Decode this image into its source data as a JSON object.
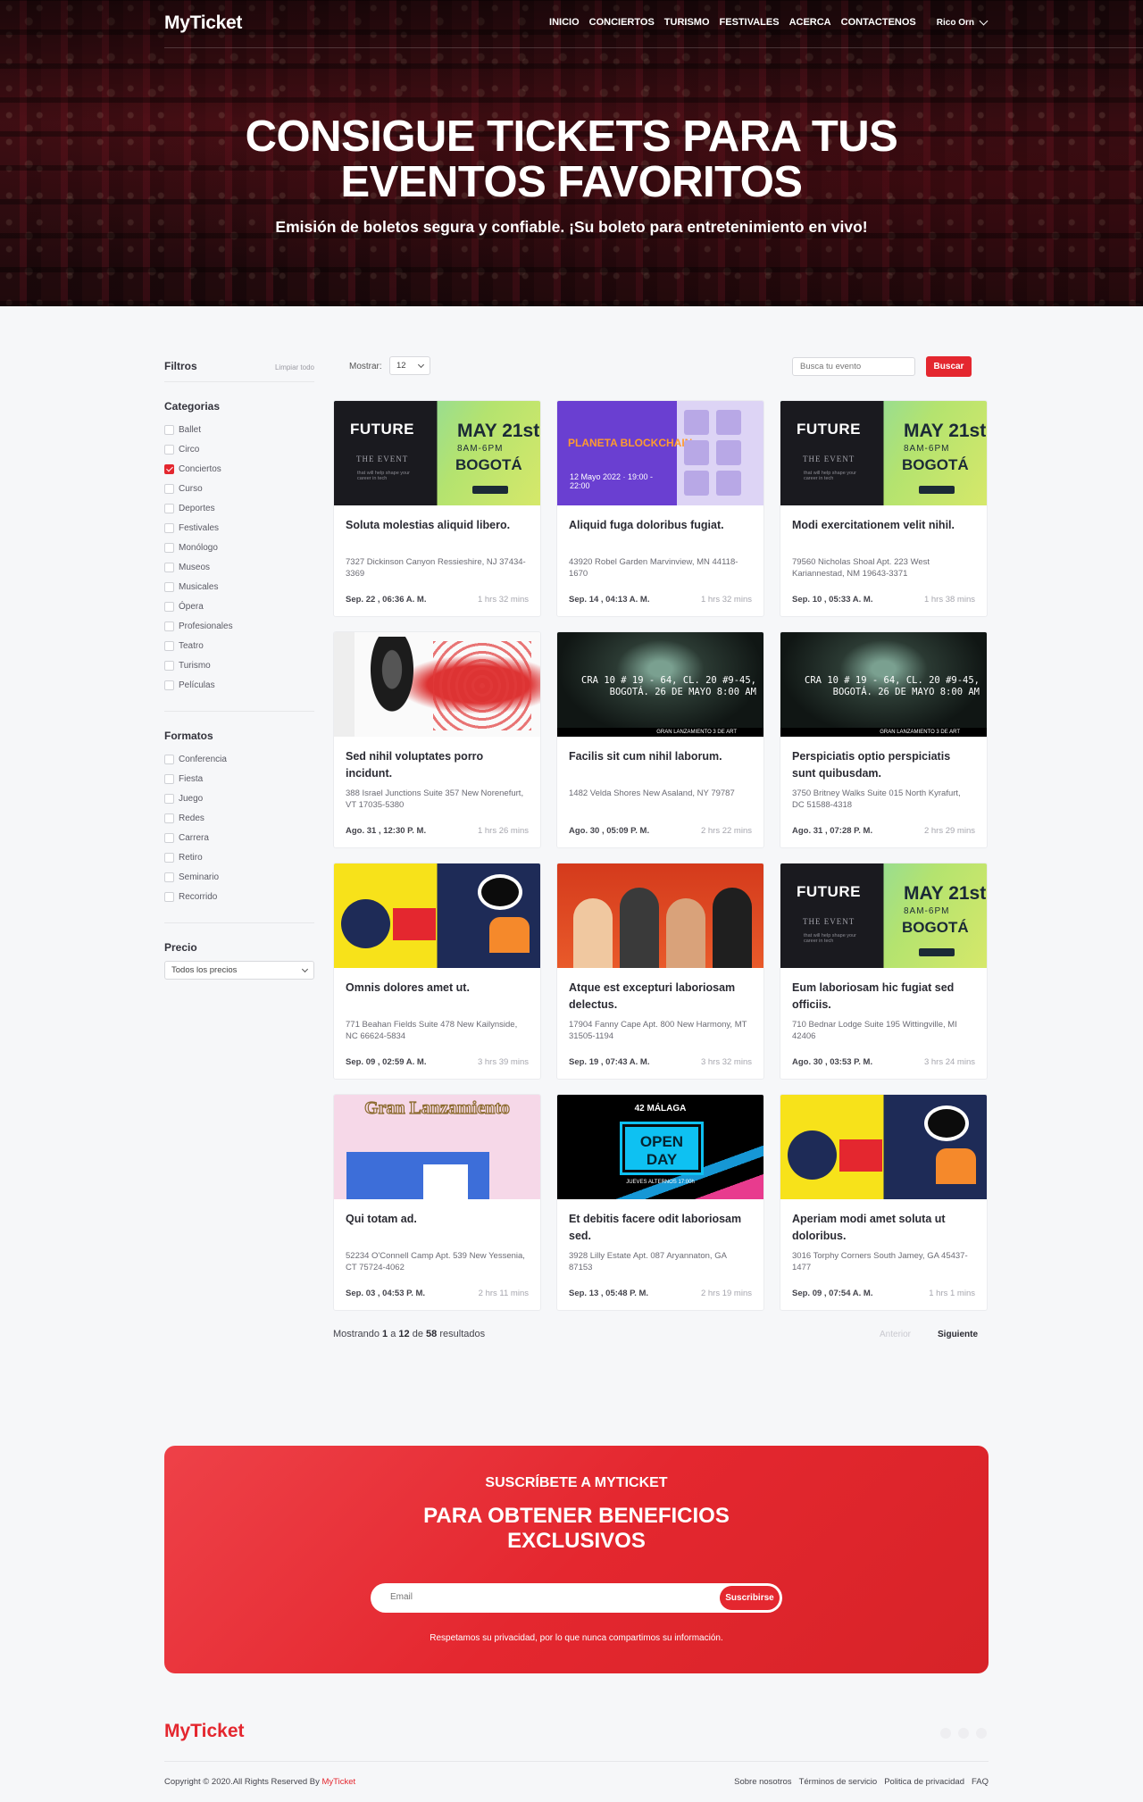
{
  "nav": {
    "logo": "MyTicket",
    "links": [
      "INICIO",
      "CONCIERTOS",
      "TURISMO",
      "FESTIVALES",
      "ACERCA",
      "CONTACTENOS"
    ],
    "user": "Rico Orn"
  },
  "hero": {
    "title_line1": "CONSIGUE TICKETS PARA TUS",
    "title_line2": "EVENTOS FAVORITOS",
    "subtitle": "Emisión de boletos segura y confiable. ¡Su boleto para entretenimiento en vivo!"
  },
  "filters": {
    "title": "Filtros",
    "clear": "Limpiar todo",
    "categories_title": "Categorias",
    "categories": [
      {
        "label": "Ballet",
        "checked": false
      },
      {
        "label": "Circo",
        "checked": false
      },
      {
        "label": "Conciertos",
        "checked": true
      },
      {
        "label": "Curso",
        "checked": false
      },
      {
        "label": "Deportes",
        "checked": false
      },
      {
        "label": "Festivales",
        "checked": false
      },
      {
        "label": "Monólogo",
        "checked": false
      },
      {
        "label": "Museos",
        "checked": false
      },
      {
        "label": "Musicales",
        "checked": false
      },
      {
        "label": "Ópera",
        "checked": false
      },
      {
        "label": "Profesionales",
        "checked": false
      },
      {
        "label": "Teatro",
        "checked": false
      },
      {
        "label": "Turismo",
        "checked": false
      },
      {
        "label": "Películas",
        "checked": false
      }
    ],
    "formats_title": "Formatos",
    "formats": [
      {
        "label": "Conferencia",
        "checked": false
      },
      {
        "label": "Fiesta",
        "checked": false
      },
      {
        "label": "Juego",
        "checked": false
      },
      {
        "label": "Redes",
        "checked": false
      },
      {
        "label": "Carrera",
        "checked": false
      },
      {
        "label": "Retiro",
        "checked": false
      },
      {
        "label": "Seminario",
        "checked": false
      },
      {
        "label": "Recorrido",
        "checked": false
      }
    ],
    "price_title": "Precio",
    "price_value": "Todos los precios"
  },
  "toolbar": {
    "show_label": "Mostrar:",
    "show_value": "12",
    "search_placeholder": "Busca tu evento",
    "search_button": "Buscar"
  },
  "thumb_text": {
    "future": {
      "title": "FUTURE",
      "event": "THE EVENT",
      "tagline": "that will help shape your career in tech",
      "date": "MAY 21st",
      "hours": "8AM-6PM",
      "city": "BOGOTÁ"
    },
    "planeta": {
      "title": "PLANETA BLOCKCHAIN",
      "date": "12 Mayo 2022 · 19:00 - 22:00"
    },
    "tunnel": {
      "address": "CRA 10 # 19 - 64, CL. 20 #9-45, BOGOTÁ. 26 DE MAYO 8:00 AM",
      "footer": "GRAN LANZAMIENTO 3 DE ART"
    },
    "gran": {
      "title": "Gran Lanzamiento"
    },
    "open": {
      "city": "42 MÁLAGA",
      "title": "OPEN DAY",
      "sub": "JUEVES ALTERNOS 17:00h"
    }
  },
  "events": [
    {
      "thumb": "future",
      "title": "Soluta molestias aliquid libero.",
      "address": "7327 Dickinson Canyon Ressieshire, NJ 37434-3369",
      "date": "Sep. 22 , 06:36 A. M.",
      "duration": "1 hrs 32 mins"
    },
    {
      "thumb": "planeta",
      "title": "Aliquid fuga doloribus fugiat.",
      "address": "43920 Robel Garden Marvinview, MN 44118-1670",
      "date": "Sep. 14 , 04:13 A. M.",
      "duration": "1 hrs 32 mins"
    },
    {
      "thumb": "future",
      "title": "Modi exercitationem velit nihil.",
      "address": "79560 Nicholas Shoal Apt. 223 West Kariannestad, NM 19643-3371",
      "date": "Sep. 10 , 05:33 A. M.",
      "duration": "1 hrs 38 mins"
    },
    {
      "thumb": "art",
      "title": "Sed nihil voluptates porro incidunt.",
      "address": "388 Israel Junctions Suite 357 New Norenefurt, VT 17035-5380",
      "date": "Ago. 31 , 12:30 P. M.",
      "duration": "1 hrs 26 mins"
    },
    {
      "thumb": "tunnel",
      "title": "Facilis sit cum nihil laborum.",
      "address": "1482 Velda Shores New Asaland, NY 79787",
      "date": "Ago. 30 , 05:09 P. M.",
      "duration": "2 hrs 22 mins"
    },
    {
      "thumb": "tunnel",
      "title": "Perspiciatis optio perspiciatis sunt quibusdam.",
      "address": "3750 Britney Walks Suite 015 North Kyrafurt, DC 51588-4318",
      "date": "Ago. 31 , 07:28 P. M.",
      "duration": "2 hrs 29 mins"
    },
    {
      "thumb": "fair",
      "title": "Omnis dolores amet ut.",
      "address": "771 Beahan Fields Suite 478 New Kailynside, NC 66624-5834",
      "date": "Sep. 09 , 02:59 A. M.",
      "duration": "3 hrs 39 mins"
    },
    {
      "thumb": "people",
      "title": "Atque est excepturi laboriosam delectus.",
      "address": "17904 Fanny Cape Apt. 800 New Harmony, MT 31505-1194",
      "date": "Sep. 19 , 07:43 A. M.",
      "duration": "3 hrs 32 mins"
    },
    {
      "thumb": "future",
      "title": "Eum laboriosam hic fugiat sed officiis.",
      "address": "710 Bednar Lodge Suite 195 Wittingville, MI 42406",
      "date": "Ago. 30 , 03:53 P. M.",
      "duration": "3 hrs 24 mins"
    },
    {
      "thumb": "gran",
      "title": "Qui totam ad.",
      "address": "52234 O'Connell Camp Apt. 539 New Yessenia, CT 75724-4062",
      "date": "Sep. 03 , 04:53 P. M.",
      "duration": "2 hrs 11 mins"
    },
    {
      "thumb": "open",
      "title": "Et debitis facere odit laboriosam sed.",
      "address": "3928 Lilly Estate Apt. 087 Aryannaton, GA 87153",
      "date": "Sep. 13 , 05:48 P. M.",
      "duration": "2 hrs 19 mins"
    },
    {
      "thumb": "fair",
      "title": "Aperiam modi amet soluta ut doloribus.",
      "address": "3016 Torphy Corners South Jamey, GA 45437-1477",
      "date": "Sep. 09 , 07:54 A. M.",
      "duration": "1 hrs 1 mins"
    }
  ],
  "pagination": {
    "prefix": "Mostrando",
    "from": "1",
    "sep1": "a",
    "to": "12",
    "sep2": "de",
    "total": "58",
    "suffix": "resultados",
    "prev": "Anterior",
    "next": "Siguiente"
  },
  "subscribe": {
    "kicker": "SUSCRÍBETE A MYTICKET",
    "head_line1": "PARA OBTENER BENEFICIOS",
    "head_line2": "EXCLUSIVOS",
    "placeholder": "Email",
    "button": "Suscribirse",
    "note": "Respetamos su privacidad, por lo que nunca compartimos su información."
  },
  "footer": {
    "logo": "MyTicket",
    "copyright": "Copyright © 2020.All Rights Reserved By",
    "brand": "MyTicket",
    "links": [
      "Sobre nosotros",
      "Términos de servicio",
      "Politica de privacidad",
      "FAQ"
    ]
  },
  "colors": {
    "accent": "#e4272f",
    "background": "#f6f7f9"
  }
}
